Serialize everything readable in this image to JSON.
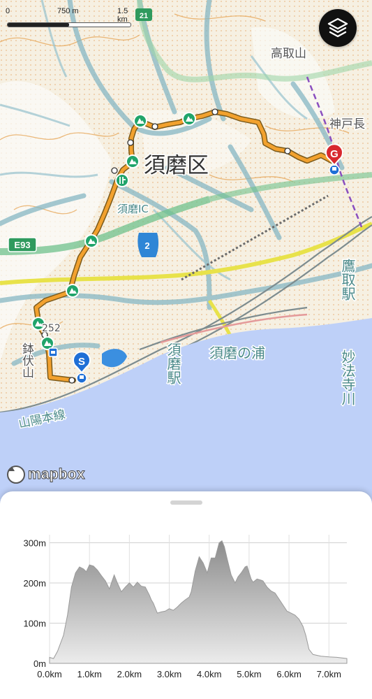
{
  "map": {
    "scale": {
      "start": "0",
      "mid": "750 m",
      "end": "1.5 km"
    },
    "labels": {
      "ward": "須磨区",
      "mountain_top": "高取山",
      "kobe_nagata": "神戸長",
      "takatori_station": "鷹取駅",
      "suma_station": "須磨駅",
      "suma_no_ura": "須磨の浦",
      "myohoji_river": "妙法寺川",
      "sanyo_line": "山陽本線",
      "suma_ic": "須磨IC",
      "hachibuseyama": "鉢伏山",
      "expressway": "E93",
      "route_2": "2",
      "road_a": "252",
      "road_b": "21"
    },
    "markers": {
      "start": "S",
      "goal": "G"
    },
    "attribution": "mapbox",
    "colors": {
      "route": "#f2a12e",
      "start_marker": "#1f6fd6",
      "goal_marker": "#d8282e",
      "sea": "#b9cffa",
      "summit_marker": "#20a46a"
    }
  },
  "elevation": {
    "y_ticks": [
      "0m",
      "100m",
      "200m",
      "300m"
    ],
    "x_ticks": [
      "0.0km",
      "1.0km",
      "2.0km",
      "3.0km",
      "4.0km",
      "5.0km",
      "6.0km",
      "7.0km"
    ],
    "y_range": [
      0,
      320
    ],
    "x_range": [
      0,
      7.45
    ],
    "profile": [
      [
        0.0,
        15
      ],
      [
        0.1,
        12
      ],
      [
        0.2,
        30
      ],
      [
        0.35,
        70
      ],
      [
        0.45,
        120
      ],
      [
        0.55,
        190
      ],
      [
        0.65,
        225
      ],
      [
        0.75,
        240
      ],
      [
        0.85,
        235
      ],
      [
        0.92,
        228
      ],
      [
        1.0,
        245
      ],
      [
        1.1,
        242
      ],
      [
        1.2,
        232
      ],
      [
        1.3,
        218
      ],
      [
        1.4,
        205
      ],
      [
        1.5,
        185
      ],
      [
        1.55,
        200
      ],
      [
        1.62,
        220
      ],
      [
        1.7,
        200
      ],
      [
        1.8,
        178
      ],
      [
        1.9,
        190
      ],
      [
        2.0,
        200
      ],
      [
        2.1,
        190
      ],
      [
        2.2,
        202
      ],
      [
        2.3,
        192
      ],
      [
        2.4,
        190
      ],
      [
        2.5,
        170
      ],
      [
        2.55,
        158
      ],
      [
        2.6,
        150
      ],
      [
        2.7,
        125
      ],
      [
        2.8,
        128
      ],
      [
        2.9,
        130
      ],
      [
        3.0,
        136
      ],
      [
        3.1,
        132
      ],
      [
        3.2,
        140
      ],
      [
        3.3,
        150
      ],
      [
        3.4,
        158
      ],
      [
        3.5,
        165
      ],
      [
        3.55,
        178
      ],
      [
        3.65,
        230
      ],
      [
        3.75,
        265
      ],
      [
        3.85,
        250
      ],
      [
        3.95,
        225
      ],
      [
        4.05,
        262
      ],
      [
        4.15,
        262
      ],
      [
        4.25,
        300
      ],
      [
        4.32,
        305
      ],
      [
        4.38,
        290
      ],
      [
        4.45,
        260
      ],
      [
        4.55,
        220
      ],
      [
        4.65,
        200
      ],
      [
        4.72,
        215
      ],
      [
        4.8,
        225
      ],
      [
        4.9,
        240
      ],
      [
        4.95,
        242
      ],
      [
        5.05,
        210
      ],
      [
        5.1,
        202
      ],
      [
        5.2,
        210
      ],
      [
        5.3,
        207
      ],
      [
        5.35,
        205
      ],
      [
        5.45,
        190
      ],
      [
        5.55,
        180
      ],
      [
        5.65,
        175
      ],
      [
        5.75,
        160
      ],
      [
        5.85,
        145
      ],
      [
        5.95,
        130
      ],
      [
        6.05,
        125
      ],
      [
        6.15,
        120
      ],
      [
        6.25,
        110
      ],
      [
        6.35,
        92
      ],
      [
        6.42,
        70
      ],
      [
        6.5,
        35
      ],
      [
        6.6,
        22
      ],
      [
        6.8,
        18
      ],
      [
        7.0,
        16
      ],
      [
        7.2,
        15
      ],
      [
        7.45,
        12
      ]
    ]
  }
}
